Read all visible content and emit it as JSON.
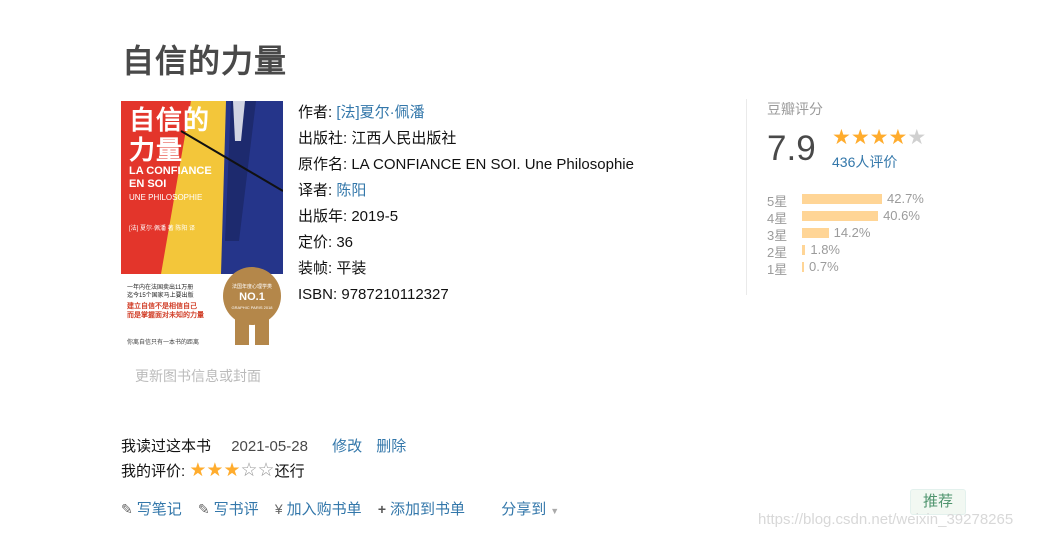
{
  "book": {
    "title": "自信的力量",
    "update_cover_link": "更新图书信息或封面",
    "cover": {
      "title_line1": "自信的",
      "title_line2": "力量",
      "sub_line1": "LA CONFIANCE",
      "sub_line2": "EN SOI",
      "sub_line3": "UNE PHILOSOPHIE",
      "author_small": "[法] 夏尔·佩潘 著 陈阳 译",
      "text1_line1": "一年内在法国卖出11万册",
      "text1_line2": "迄今15个国家马上要出版",
      "text2_line1": "建立自信不是相信自己",
      "text2_line2": "而是掌握面对未知的力量",
      "text3": "你离自信只有一本书的距离",
      "badge_top": "法国年度心理学类",
      "badge_main": "NO.1",
      "badge_bottom": "GRAPHIC PARIS 2018"
    }
  },
  "info": {
    "author_label": "作者:",
    "author_value": "[法]夏尔·佩潘",
    "publisher_label": "出版社:",
    "publisher_value": "江西人民出版社",
    "original_title_label": "原作名:",
    "original_title_value": "LA CONFIANCE EN SOI. Une Philosophie",
    "translator_label": "译者:",
    "translator_value": "陈阳",
    "pub_year_label": "出版年:",
    "pub_year_value": "2019-5",
    "price_label": "定价:",
    "price_value": "36",
    "binding_label": "装帧:",
    "binding_value": "平装",
    "isbn_label": "ISBN:",
    "isbn_value": "9787210112327"
  },
  "rating": {
    "label": "豆瓣评分",
    "score": "7.9",
    "stars": 4,
    "count_text": "436人评价",
    "star_filled_color": "#ffac2d",
    "star_empty_color": "#d0d0d0",
    "bar_color": "#ffd596",
    "breakdown": [
      {
        "label": "5星",
        "percent": 42.7,
        "text": "42.7%"
      },
      {
        "label": "4星",
        "percent": 40.6,
        "text": "40.6%"
      },
      {
        "label": "3星",
        "percent": 14.2,
        "text": "14.2%"
      },
      {
        "label": "2星",
        "percent": 1.8,
        "text": "1.8%"
      },
      {
        "label": "1星",
        "percent": 0.7,
        "text": "0.7%"
      }
    ]
  },
  "my_status": {
    "read_label": "我读过这本书",
    "date": "2021-05-28",
    "edit_link": "修改",
    "delete_link": "删除",
    "my_rating_label": "我的评价:",
    "my_stars": 3,
    "my_rating_text": "还行"
  },
  "actions": {
    "write_note": "写笔记",
    "write_review": "写书评",
    "add_cart": "加入购书单",
    "add_list": "添加到书单",
    "share": "分享到",
    "recommend": "推荐"
  },
  "watermark": "https://blog.csdn.net/weixin_39278265"
}
